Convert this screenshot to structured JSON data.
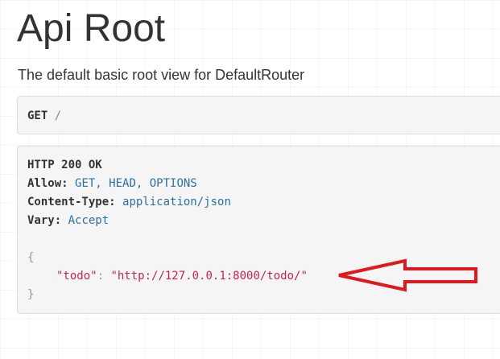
{
  "page": {
    "title": "Api Root",
    "description": "The default basic root view for DefaultRouter"
  },
  "request": {
    "method": "GET",
    "path": "/"
  },
  "response": {
    "status": "HTTP 200 OK",
    "headers": [
      {
        "key": "Allow:",
        "value": "GET, HEAD, OPTIONS"
      },
      {
        "key": "Content-Type:",
        "value": "application/json"
      },
      {
        "key": "Vary:",
        "value": "Accept"
      }
    ],
    "body": {
      "open_brace": "{",
      "key": "\"todo\"",
      "colon": ":",
      "value": "\"http://127.0.0.1:8000/todo/\"",
      "close_brace": "}"
    }
  },
  "colors": {
    "arrow": "#e0191f",
    "json_string": "#c7254e",
    "header_value": "#2f6f9f"
  },
  "annotation": {
    "icon": "red-arrow-icon"
  }
}
